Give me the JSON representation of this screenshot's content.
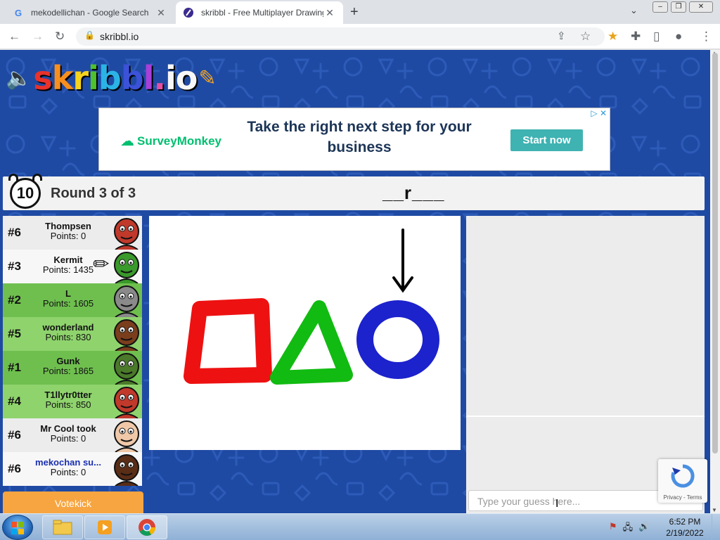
{
  "browser": {
    "tabs": [
      {
        "title": "mekodellichan - Google Search",
        "favicon": "google-icon",
        "active": false
      },
      {
        "title": "skribbl - Free Multiplayer Drawing",
        "favicon": "skribbl-icon",
        "active": true
      }
    ],
    "url": "skribbl.io"
  },
  "ad": {
    "brand": "SurveyMonkey",
    "headline": "Take the right next step for your business",
    "cta": "Start now"
  },
  "game": {
    "timer": "10",
    "round_text": "Round 3 of 3",
    "word_hint": "__r___"
  },
  "players": [
    {
      "rank": "#6",
      "name": "Thompsen",
      "points": "Points: 0",
      "avatar_color": "#c0392b",
      "row_color": "#ececec",
      "drawing": false,
      "name_color": "#111111"
    },
    {
      "rank": "#3",
      "name": "Kermit",
      "points": "Points: 1435",
      "avatar_color": "#3a9a2b",
      "row_color": "#f7f7f7",
      "drawing": true,
      "name_color": "#111111"
    },
    {
      "rank": "#2",
      "name": "L",
      "points": "Points: 1605",
      "avatar_color": "#8a8a8a",
      "row_color": "#6fbf4f",
      "drawing": false,
      "name_color": "#111111"
    },
    {
      "rank": "#5",
      "name": "wonderland",
      "points": "Points: 830",
      "avatar_color": "#7a3e1d",
      "row_color": "#8fd36d",
      "drawing": false,
      "name_color": "#111111"
    },
    {
      "rank": "#1",
      "name": "Gunk",
      "points": "Points: 1865",
      "avatar_color": "#4a7a2a",
      "row_color": "#6fbf4f",
      "drawing": false,
      "name_color": "#111111"
    },
    {
      "rank": "#4",
      "name": "T1llytr0tter",
      "points": "Points: 850",
      "avatar_color": "#c0392b",
      "row_color": "#8fd36d",
      "drawing": false,
      "name_color": "#111111"
    },
    {
      "rank": "#6",
      "name": "Mr Cool took",
      "points": "Points: 0",
      "avatar_color": "#f0c8a8",
      "row_color": "#ececec",
      "drawing": false,
      "name_color": "#111111"
    },
    {
      "rank": "#6",
      "name": "mekochan su...",
      "points": "Points: 0",
      "avatar_color": "#5a2d16",
      "row_color": "#f7f7f7",
      "drawing": false,
      "name_color": "#1a2fb0"
    }
  ],
  "votekick_label": "Votekick",
  "chat": {
    "placeholder": "Type your guess here..."
  },
  "recaptcha": {
    "links": "Privacy - Terms"
  },
  "taskbar": {
    "time": "6:52 PM",
    "date": "2/19/2022"
  },
  "drawing": {
    "shapes": [
      {
        "shape": "square",
        "color": "#ee1111"
      },
      {
        "shape": "triangle",
        "color": "#11bb11"
      },
      {
        "shape": "circle",
        "color": "#1c22cc"
      },
      {
        "shape": "arrow",
        "color": "#000000"
      }
    ]
  }
}
